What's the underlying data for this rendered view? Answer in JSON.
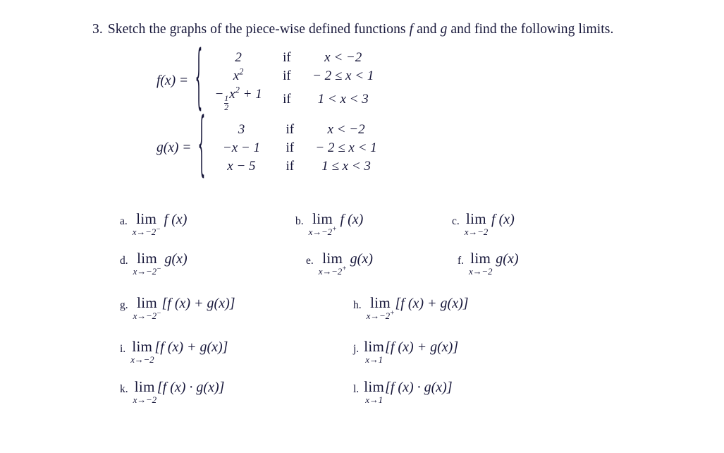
{
  "document": {
    "background_color": "#ffffff",
    "text_color": "#17173a",
    "problem_number": "3.",
    "prompt_part1": "Sketch the graphs of the piece-wise defined functions",
    "prompt_f": "f",
    "prompt_and1": "and",
    "prompt_g": "g",
    "prompt_part2": "and find the following limits."
  },
  "piecewise": {
    "f": {
      "lhs": "f(x) =",
      "rows": [
        {
          "expr": "2",
          "if": "if",
          "cond": "x < −2"
        },
        {
          "expr": "x",
          "expr_sup": "2",
          "if": "if",
          "cond": "− 2 ≤ x < 1"
        },
        {
          "expr": "−",
          "expr_frac_num": "1",
          "expr_frac_den": "2",
          "expr_tail": "x",
          "expr_sup": "2",
          "expr_tail2": "+ 1",
          "if": "if",
          "cond": "1 < x < 3"
        }
      ]
    },
    "g": {
      "lhs": "g(x) =",
      "rows": [
        {
          "expr": "3",
          "if": "if",
          "cond": "x < −2"
        },
        {
          "expr": "−x − 1",
          "if": "if",
          "cond": "− 2 ≤ x < 1"
        },
        {
          "expr": "x − 5",
          "if": "if",
          "cond": "1 ≤ x < 3"
        }
      ]
    }
  },
  "limits": [
    {
      "label": "a.",
      "lim": "lim",
      "sub": "x→−2",
      "sub_sign": "−",
      "body": "f (x)"
    },
    {
      "label": "b.",
      "lim": "lim",
      "sub": "x→−2",
      "sub_sign": "+",
      "body": "f (x)"
    },
    {
      "label": "c.",
      "lim": "lim",
      "sub": "x→−2",
      "sub_sign": "",
      "body": "f (x)"
    },
    {
      "label": "d.",
      "lim": "lim",
      "sub": "x→−2",
      "sub_sign": "−",
      "body": "g(x)"
    },
    {
      "label": "e.",
      "lim": "lim",
      "sub": "x→−2",
      "sub_sign": "+",
      "body": "g(x)"
    },
    {
      "label": "f.",
      "lim": "lim",
      "sub": "x→−2",
      "sub_sign": "",
      "body": "g(x)"
    },
    {
      "label": "g.",
      "lim": "lim",
      "sub": "x→−2",
      "sub_sign": "−",
      "body": "[f (x) + g(x)]"
    },
    {
      "label": "h.",
      "lim": "lim",
      "sub": "x→−2",
      "sub_sign": "+",
      "body": "[f (x) + g(x)]"
    },
    {
      "label": "i.",
      "lim": "lim",
      "sub": "x→−2",
      "sub_sign": "",
      "body": "[f (x) + g(x)]"
    },
    {
      "label": "j.",
      "lim": "lim",
      "sub": "x→1",
      "sub_sign": "",
      "body": "[f (x) + g(x)]"
    },
    {
      "label": "k.",
      "lim": "lim",
      "sub": "x→−2",
      "sub_sign": "",
      "body": "[f (x) · g(x)]"
    },
    {
      "label": "l.",
      "lim": "lim",
      "sub": "x→1",
      "sub_sign": "",
      "body": "[f (x) · g(x)]"
    }
  ]
}
